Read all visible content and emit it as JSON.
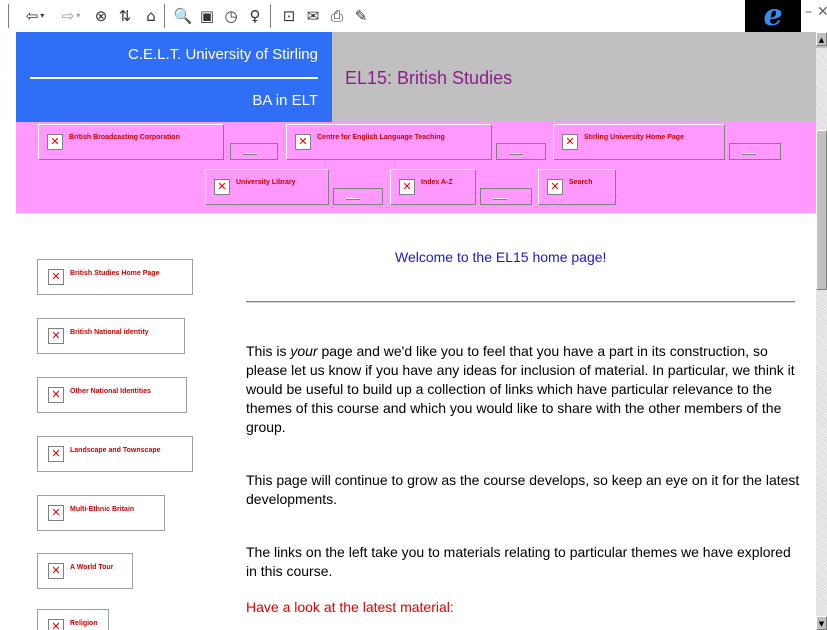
{
  "toolbar": {
    "buttons": [
      {
        "icon": "back-arrow-icon",
        "glyph": "⇦"
      },
      {
        "icon": "forward-arrow-icon",
        "glyph": "⇨"
      },
      {
        "icon": "stop-icon",
        "glyph": "⊗"
      },
      {
        "icon": "refresh-icon",
        "glyph": "⇅"
      },
      {
        "icon": "home-icon",
        "glyph": "⌂"
      },
      {
        "icon": "search-icon",
        "glyph": "🔍"
      },
      {
        "icon": "favorites-icon",
        "glyph": "▣"
      },
      {
        "icon": "history-icon",
        "glyph": "◷"
      },
      {
        "icon": "channels-icon",
        "glyph": "♀"
      },
      {
        "icon": "fullscreen-icon",
        "glyph": "⊡"
      },
      {
        "icon": "mail-icon",
        "glyph": "✉"
      },
      {
        "icon": "print-icon",
        "glyph": "⎙"
      },
      {
        "icon": "edit-icon",
        "glyph": "✎"
      }
    ],
    "dropdown_glyph": "▾",
    "ie_logo": "e",
    "minimize_glyph": "–",
    "close_glyph": "✕"
  },
  "header": {
    "university": "C.E.L.T. University of Stirling",
    "degree": "BA in ELT",
    "course": "EL15: British Studies"
  },
  "top_links": [
    "British Broadcasting Corporation",
    "Centre for English Language Teaching",
    "Stirling University Home Page",
    "University Library",
    "Index A-Z",
    "Search"
  ],
  "side_links": [
    "British Studies Home Page",
    "British National identity",
    "Other National Identities",
    "Landscape and Townscape",
    "Multi-Ethnic Britain",
    "A World Tour",
    "Religion"
  ],
  "broken_image_glyph": "✕",
  "main": {
    "welcome": "Welcome to the EL15 home page!",
    "para1_before": "This is ",
    "para1_emph": "your",
    "para1_after": " page and we'd like you to feel that you have a part in its construction, so please let us know if you have any ideas for inclusion of material. In particular, we think it would be useful to build up a collection of links which have particular relevance to the themes of this course and which you would like to share with the other members of the group.",
    "para2": "This page will continue to grow as the course develops, so keep an eye on it for the latest developments.",
    "para3": "The links on the left take you to materials relating to particular themes we have explored in this course.",
    "latest": "Have a look at the latest material:"
  },
  "scrollbar": {
    "up": "▲",
    "down": "▼"
  },
  "colors": {
    "header_blue": "#2f6ff5",
    "header_grey": "#c0c0c0",
    "nav_pink": "#ff99ff",
    "course_title": "#8a1e8a",
    "link_red": "#cc0000",
    "welcome_blue": "#1a1acc"
  }
}
